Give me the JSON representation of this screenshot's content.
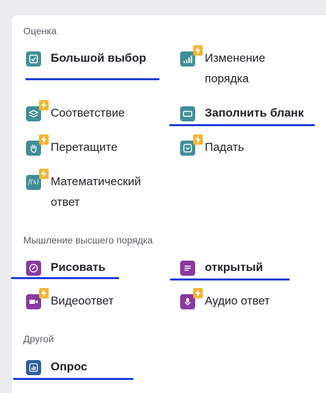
{
  "sections": {
    "assessment": "Оценка",
    "higher_order": "Мышление высшего порядка",
    "other": "Другой"
  },
  "items": {
    "multiple_choice": "Большой выбор",
    "reorder": "Изменение порядка",
    "match": "Соответствие",
    "fill_blank": "Заполнить бланк",
    "drag": "Перетащите",
    "drop": "Падать",
    "math": "Математический ответ",
    "draw": "Рисовать",
    "open": "открытый",
    "video": "Видеоответ",
    "audio": "Аудио ответ",
    "poll": "Опрос"
  },
  "colors": {
    "teal": "#3f8f98",
    "purple": "#8a3aa0",
    "navy": "#2f5f9c",
    "bolt": "#f3b533",
    "underline": "#1f3fd6"
  },
  "icons": {
    "multiple_choice": "checkbox-icon",
    "reorder": "bars-icon",
    "match": "layers-icon",
    "fill_blank": "input-box-icon",
    "drag": "hand-icon",
    "drop": "dropdown-icon",
    "math": "function-icon",
    "draw": "pencil-icon",
    "open": "text-lines-icon",
    "video": "video-camera-icon",
    "audio": "microphone-icon",
    "poll": "bar-chart-icon",
    "premium": "lightning-icon"
  }
}
